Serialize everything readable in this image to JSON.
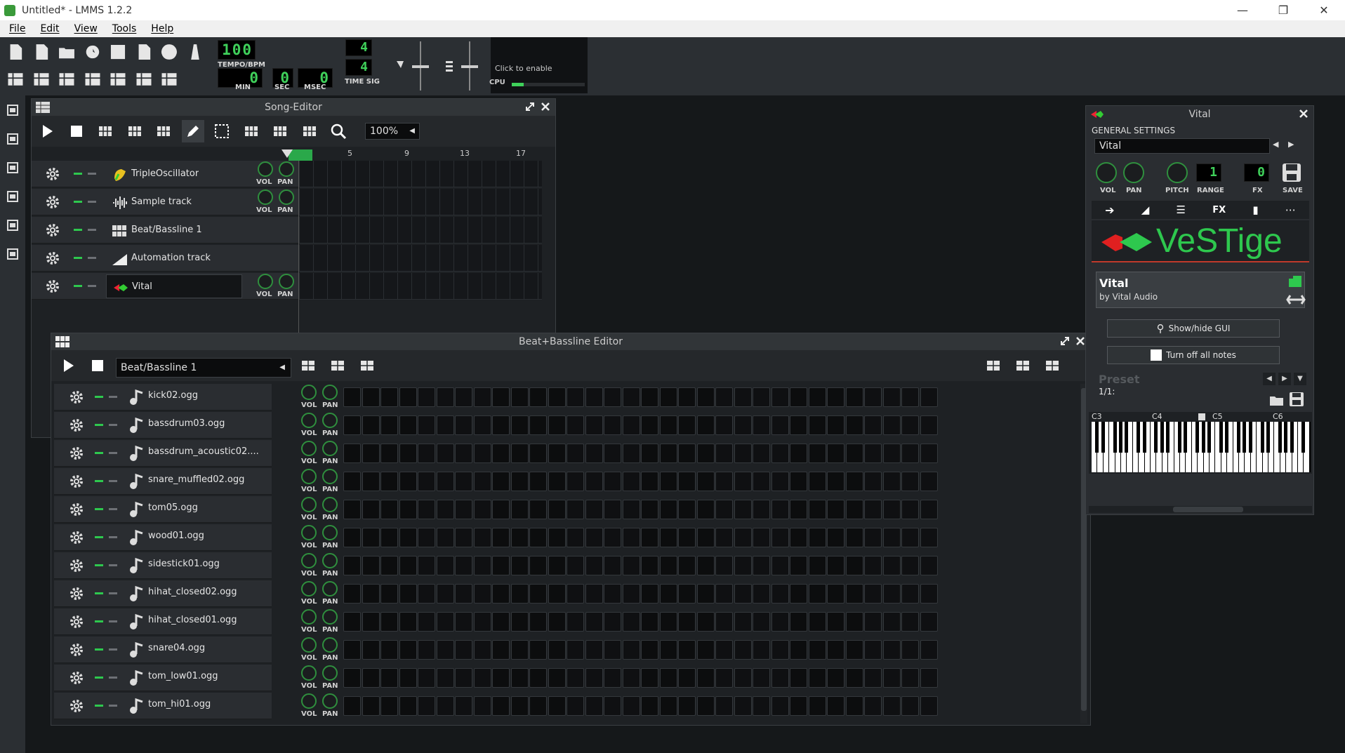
{
  "window": {
    "title": "Untitled* - LMMS 1.2.2"
  },
  "menu": [
    "File",
    "Edit",
    "View",
    "Tools",
    "Help"
  ],
  "transport": {
    "tempo": "100",
    "tempo_label": "TEMPO/BPM",
    "min": "0",
    "sec": "0",
    "msec": "0",
    "min_label": "MIN",
    "sec_label": "SEC",
    "msec_label": "MSEC",
    "timesig_num": "4",
    "timesig_den": "4",
    "timesig_label": "TIME SIG",
    "cpu_hint": "Click to enable",
    "cpu_label": "CPU"
  },
  "song_editor": {
    "title": "Song-Editor",
    "zoom": "100%",
    "bars": [
      "5",
      "9",
      "13",
      "17"
    ],
    "tracks": [
      {
        "name": "TripleOscillator",
        "kind": "instrument",
        "has_knobs": true
      },
      {
        "name": "Sample track",
        "kind": "sample",
        "has_knobs": true
      },
      {
        "name": "Beat/Bassline 1",
        "kind": "beat",
        "has_knobs": false
      },
      {
        "name": "Automation track",
        "kind": "automation",
        "has_knobs": false
      },
      {
        "name": "Vital",
        "kind": "vst",
        "has_knobs": true
      }
    ]
  },
  "beat_editor": {
    "title": "Beat+Bassline Editor",
    "selected": "Beat/Bassline 1",
    "tracks": [
      "kick02.ogg",
      "bassdrum03.ogg",
      "bassdrum_acoustic02....",
      "snare_muffled02.ogg",
      "tom05.ogg",
      "wood01.ogg",
      "sidestick01.ogg",
      "hihat_closed02.ogg",
      "hihat_closed01.ogg",
      "snare04.ogg",
      "tom_low01.ogg",
      "tom_hi01.ogg"
    ]
  },
  "vital": {
    "title": "Vital",
    "general": "GENERAL SETTINGS",
    "preset_name": "Vital",
    "range": "1",
    "fx": "0",
    "vol": "VOL",
    "pan": "PAN",
    "pitch": "PITCH",
    "range_label": "RANGE",
    "fx_label": "FX",
    "save_label": "SAVE",
    "tab_fx": "FX",
    "logo": "VeSTige",
    "plugin_name": "Vital",
    "plugin_vendor": "by Vital Audio",
    "show_gui": "Show/hide GUI",
    "turn_off": "Turn off all notes",
    "preset_label": "Preset",
    "preset_pos": "1/1:",
    "octaves": [
      "C3",
      "C4",
      "C5",
      "C6"
    ]
  },
  "labels": {
    "vol": "VOL",
    "pan": "PAN"
  },
  "colors": {
    "accent": "#2ec84e",
    "lcd": "#3fd05a",
    "bg": "#1e2124"
  }
}
